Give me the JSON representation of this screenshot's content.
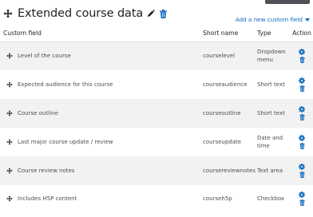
{
  "header": {
    "title": "Extended course data",
    "add_link": "Add a new custom field"
  },
  "table": {
    "columns": [
      "Custom field",
      "Short name",
      "Type",
      "Action"
    ],
    "rows": [
      {
        "field": "Level of the course",
        "shortname": "courselevel",
        "type": "Dropdown menu"
      },
      {
        "field": "Expected audience for this course",
        "shortname": "courseaudience",
        "type": "Short text"
      },
      {
        "field": "Course outline",
        "shortname": "courseoutline",
        "type": "Short text"
      },
      {
        "field": "Last major course update / review",
        "shortname": "courseupdate",
        "type": "Date and time"
      },
      {
        "field": "Course review notes",
        "shortname": "coursereviewnotes",
        "type": "Text area"
      },
      {
        "field": "Includes H5P content",
        "shortname": "courseh5p",
        "type": "Checkbox"
      }
    ]
  },
  "icons": {
    "move": "move-arrows-icon",
    "edit": "pencil-icon",
    "delete": "trash-icon",
    "settings": "gear-icon",
    "dropdown": "caret-down-icon"
  },
  "colors": {
    "link": "#0f6cbf",
    "icon_blue": "#0f6cbf",
    "text": "#1d2125",
    "muted_text": "#495057",
    "row_stripe": "#f2f2f2"
  }
}
